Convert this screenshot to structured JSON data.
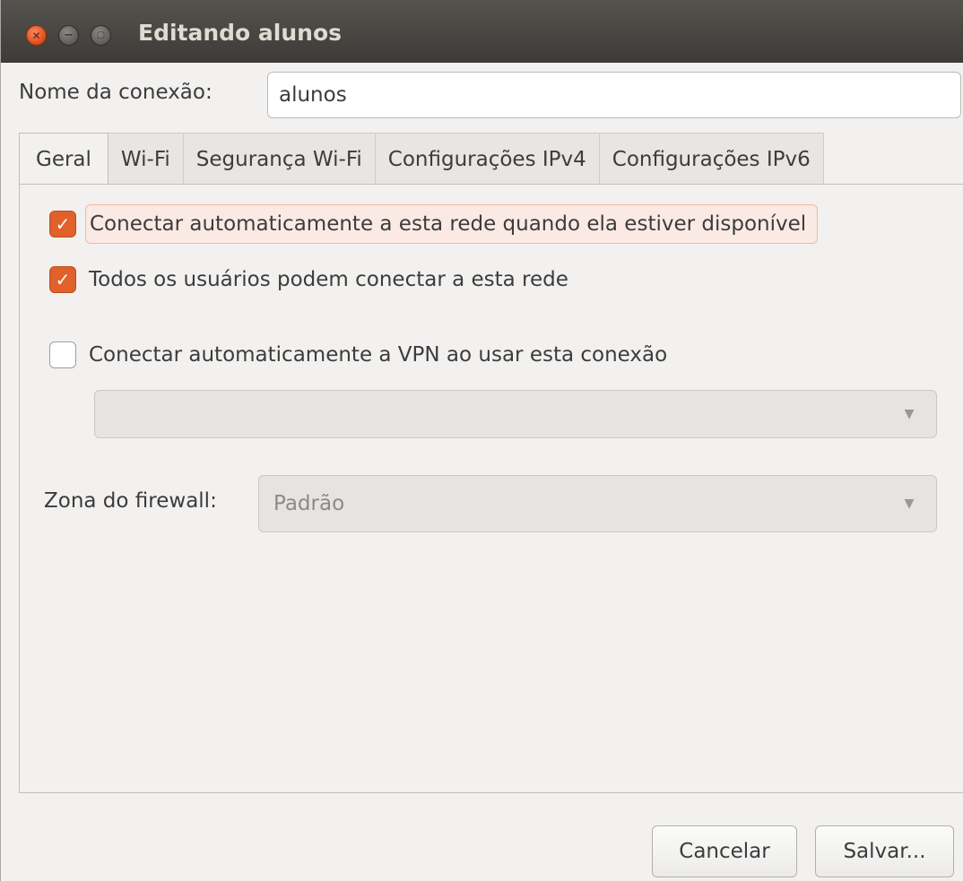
{
  "window": {
    "title": "Editando alunos",
    "close_icon": "close-icon",
    "minimize_icon": "minimize-icon",
    "maximize_icon": "maximize-icon"
  },
  "connection": {
    "name_label": "Nome da conexão:",
    "name_value": "alunos"
  },
  "tabs": [
    {
      "label": "Geral",
      "active": true
    },
    {
      "label": "Wi-Fi",
      "active": false
    },
    {
      "label": "Segurança Wi-Fi",
      "active": false
    },
    {
      "label": "Configurações IPv4",
      "active": false
    },
    {
      "label": "Configurações IPv6",
      "active": false
    }
  ],
  "general": {
    "auto_connect": {
      "label": "Conectar automaticamente a esta rede quando ela estiver disponível",
      "checked": true
    },
    "all_users": {
      "label": "Todos os usuários podem conectar a esta rede",
      "checked": true
    },
    "vpn_auto": {
      "label": "Conectar automaticamente a VPN ao usar esta conexão",
      "checked": false
    },
    "vpn_select": {
      "value": ""
    },
    "firewall": {
      "label": "Zona do firewall:",
      "value": "Padrão"
    }
  },
  "buttons": {
    "cancel": "Cancelar",
    "save": "Salvar..."
  },
  "colors": {
    "accent": "#e0612a",
    "titlebar": "#3c3b37",
    "background": "#f2f1f0"
  }
}
